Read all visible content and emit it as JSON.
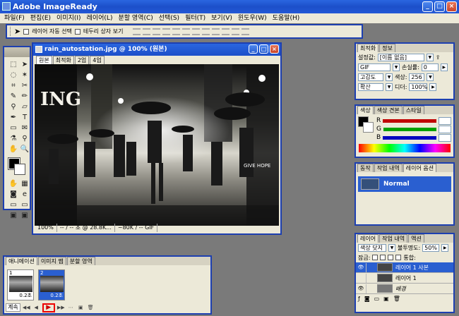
{
  "app": {
    "title": "Adobe ImageReady"
  },
  "menu": [
    "파일(F)",
    "편집(E)",
    "이미지(I)",
    "레이어(L)",
    "분할 영역(C)",
    "선택(S)",
    "필터(T)",
    "보기(V)",
    "윈도우(W)",
    "도움말(H)"
  ],
  "options": {
    "auto_select": "레이어 자동 선택",
    "show_bounds": "테두리 상자 보기"
  },
  "document": {
    "title": "rain_autostation.jpg @ 100% (원본)",
    "tabs": [
      "원본",
      "최적화",
      "2업",
      "4업"
    ],
    "zoom": "100%",
    "status_time": "-- / -- 초 @ 28.8K...",
    "status_size": "~80K / -- GIF",
    "photo_sign_1": "ING",
    "photo_sign_2": "GIVE HOPE"
  },
  "optimize_panel": {
    "tabs": [
      "최적화",
      "정보"
    ],
    "preset_label": "설정값:",
    "preset_value": "[이름 없음]",
    "format": "GIF",
    "lossy_label": "손실률:",
    "lossy_value": "0",
    "reduction": "고감도",
    "colors_label": "색상:",
    "colors_value": "256",
    "dither_method": "확산",
    "dither_label": "디더:",
    "dither_value": "100%"
  },
  "color_panel": {
    "tabs": [
      "색상",
      "색상 견본",
      "스타일"
    ],
    "channels": [
      "R",
      "G",
      "B"
    ],
    "colors": {
      "r": "#c00000",
      "g": "#00a000",
      "b": "#0000c0"
    }
  },
  "history_panel": {
    "tabs": [
      "동작",
      "작업 내역",
      "레이어 옵션"
    ],
    "blend": "Normal"
  },
  "layers_panel": {
    "tabs": [
      "레이어",
      "작업 내역",
      "액션"
    ],
    "blend_mode": "색상 닷지",
    "opacity_label": "불투명도:",
    "opacity_value": "50%",
    "lock_label": "잠금:",
    "fill_label": "통합:",
    "layers": [
      {
        "name": "레이어 1 사본"
      },
      {
        "name": "레이어 1"
      },
      {
        "name": "배경"
      }
    ]
  },
  "animation_panel": {
    "tabs": [
      "애니메이션",
      "이미지 맵",
      "분할 영역"
    ],
    "frames": [
      {
        "num": "1",
        "delay": "0.2초"
      },
      {
        "num": "2",
        "delay": "0.2초"
      }
    ],
    "loop": "계속"
  }
}
